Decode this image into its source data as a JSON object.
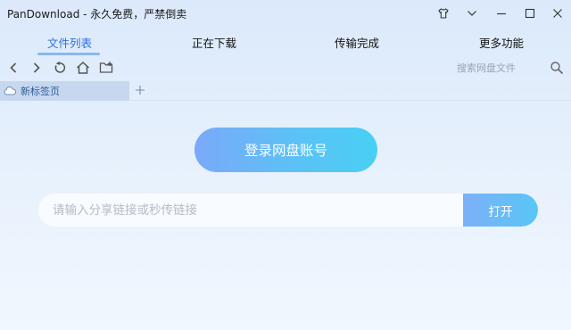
{
  "window": {
    "title": "PanDownload - 永久免费，严禁倒卖"
  },
  "main_tabs": [
    {
      "label": "文件列表",
      "active": true
    },
    {
      "label": "正在下载",
      "active": false
    },
    {
      "label": "传输完成",
      "active": false
    },
    {
      "label": "更多功能",
      "active": false
    }
  ],
  "toolbar": {
    "search_placeholder": "搜索网盘文件",
    "icons": [
      "back-icon",
      "forward-icon",
      "refresh-icon",
      "home-icon",
      "new-folder-icon",
      "search-icon"
    ]
  },
  "browser_tabs": [
    {
      "label": "新标签页"
    }
  ],
  "login": {
    "button_label": "登录网盘账号"
  },
  "share": {
    "placeholder": "请输入分享链接或秒传链接",
    "value": "",
    "open_label": "打开"
  },
  "colors": {
    "accent": "#2f6fd6",
    "tab_underline": "#8bb8ec",
    "button_gradient_start": "#7aa9f8",
    "button_gradient_end": "#48d0f4"
  }
}
